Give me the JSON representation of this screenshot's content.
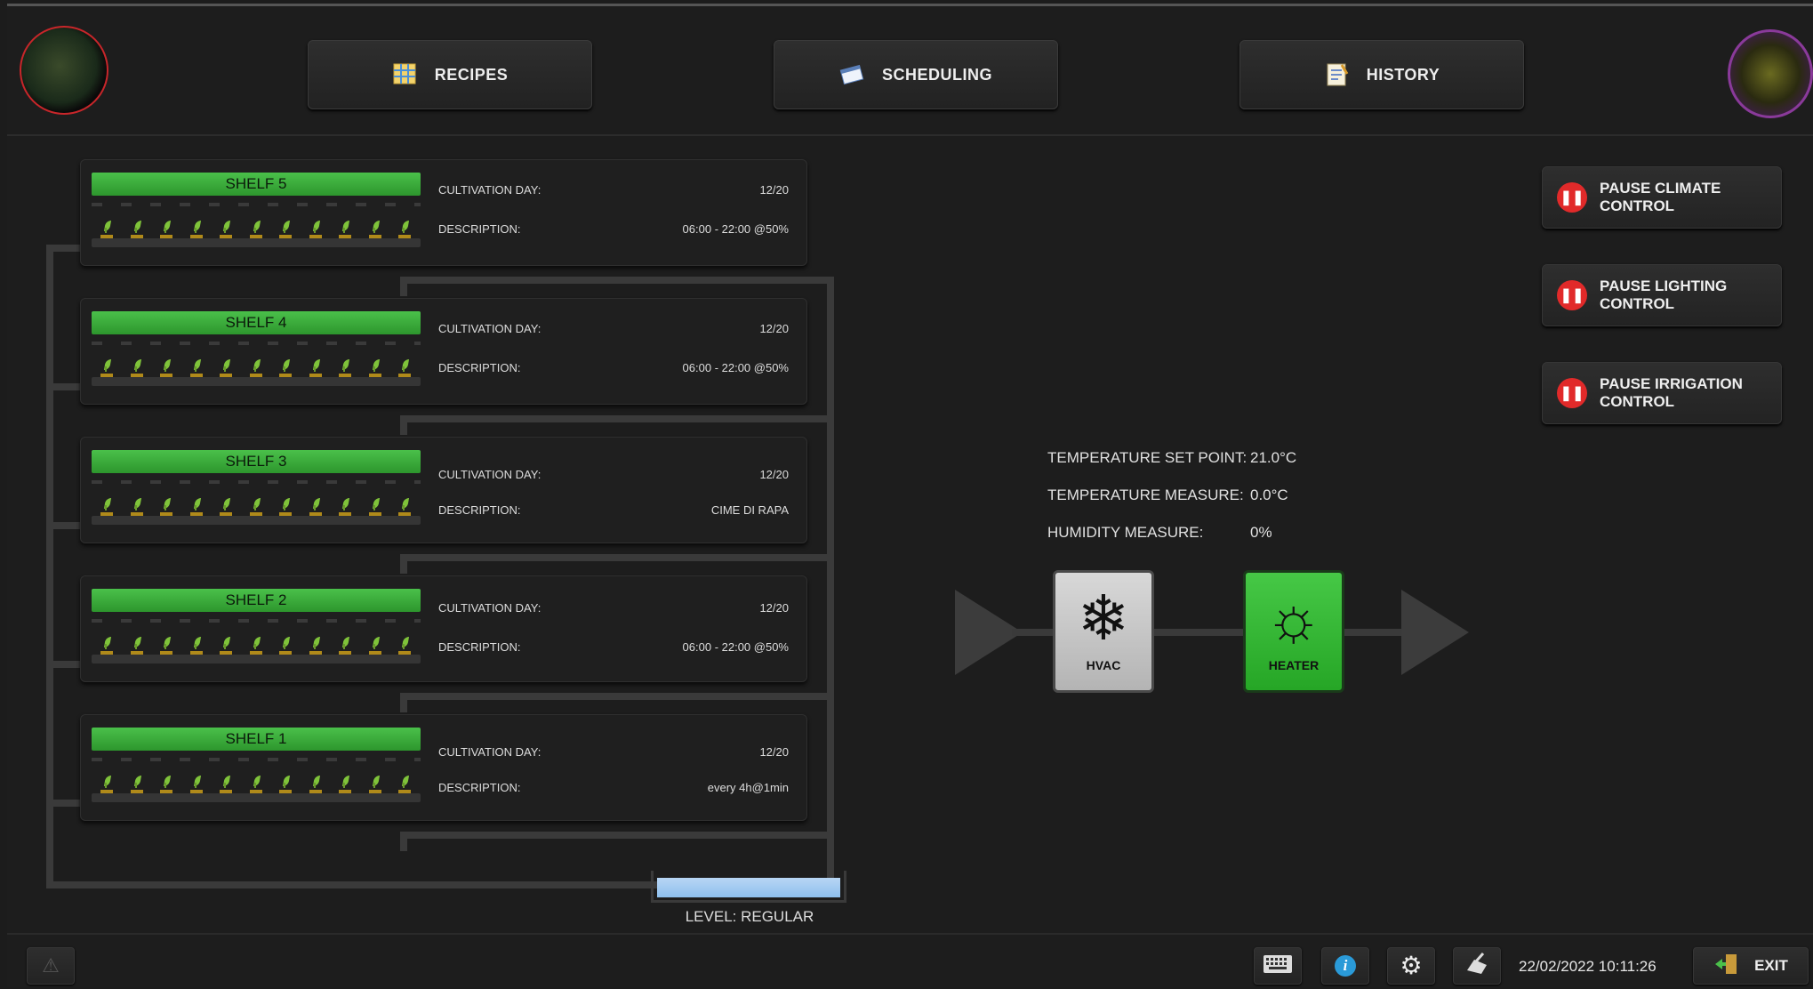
{
  "nav": {
    "recipes_label": "RECIPES",
    "scheduling_label": "SCHEDULING",
    "history_label": "HISTORY"
  },
  "shelves": [
    {
      "name": "SHELF 5",
      "cultivation_day_label": "CULTIVATION DAY:",
      "cultivation_day": "12/20",
      "description_label": "DESCRIPTION:",
      "description": "06:00 - 22:00 @50%"
    },
    {
      "name": "SHELF 4",
      "cultivation_day_label": "CULTIVATION DAY:",
      "cultivation_day": "12/20",
      "description_label": "DESCRIPTION:",
      "description": "06:00 - 22:00 @50%"
    },
    {
      "name": "SHELF 3",
      "cultivation_day_label": "CULTIVATION DAY:",
      "cultivation_day": "12/20",
      "description_label": "DESCRIPTION:",
      "description": "CIME DI RAPA"
    },
    {
      "name": "SHELF 2",
      "cultivation_day_label": "CULTIVATION DAY:",
      "cultivation_day": "12/20",
      "description_label": "DESCRIPTION:",
      "description": "06:00 - 22:00 @50%"
    },
    {
      "name": "SHELF 1",
      "cultivation_day_label": "CULTIVATION DAY:",
      "cultivation_day": "12/20",
      "description_label": "DESCRIPTION:",
      "description": "every 4h@1min"
    }
  ],
  "tank": {
    "level_text": "LEVEL: REGULAR"
  },
  "controls": {
    "pause_climate": "PAUSE CLIMATE CONTROL",
    "pause_lighting": "PAUSE LIGHTING CONTROL",
    "pause_irrigation": "PAUSE IRRIGATION CONTROL"
  },
  "climate": {
    "setpoint_label": "TEMPERATURE SET POINT:",
    "setpoint_value": "21.0°C",
    "temp_label": "TEMPERATURE MEASURE:",
    "temp_value": "0.0°C",
    "humidity_label": "HUMIDITY MEASURE:",
    "humidity_value": "0%",
    "hvac_label": "HVAC",
    "heater_label": "HEATER"
  },
  "footer": {
    "datetime": "22/02/2022 10:11:26",
    "exit_label": "EXIT"
  },
  "colors": {
    "shelf_active": "#3fb53f",
    "heater_on": "#36b836",
    "pause_red": "#e12a2a",
    "water": "#a6ccf2"
  }
}
